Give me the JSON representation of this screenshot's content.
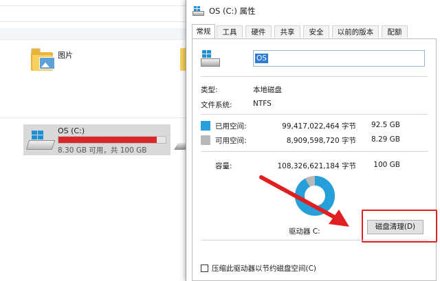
{
  "explorer": {
    "folder_label": "图片",
    "drive": {
      "name": "OS (C:)",
      "subtitle": "8.30 GB 可用，共 100 GB",
      "used_fraction": 0.917
    }
  },
  "dialog": {
    "title": "OS (C:) 属性",
    "tabs": [
      {
        "label": "常规",
        "active": true
      },
      {
        "label": "工具"
      },
      {
        "label": "硬件"
      },
      {
        "label": "共享"
      },
      {
        "label": "安全"
      },
      {
        "label": "以前的版本"
      },
      {
        "label": "配额"
      }
    ],
    "drive_label_value": "OS",
    "type_label": "类型:",
    "type_value": "本地磁盘",
    "fs_label": "文件系统:",
    "fs_value": "NTFS",
    "used": {
      "label": "已用空间:",
      "bytes": "99,417,022,464 字节",
      "size": "92.5 GB",
      "color": "#26a0da"
    },
    "free": {
      "label": "可用空间:",
      "bytes": "8,909,598,720 字节",
      "size": "8.29 GB",
      "color": "#b9b9b9"
    },
    "capacity": {
      "label": "容量:",
      "bytes": "108,326,621,184 字节",
      "size": "100 GB"
    },
    "drive_caption": "驱动器 C:",
    "cleanup_button": "磁盘清理(D)",
    "compress_checkbox": "压缩此驱动器以节约磁盘空间(C)",
    "highlight_color": "#e02020"
  }
}
